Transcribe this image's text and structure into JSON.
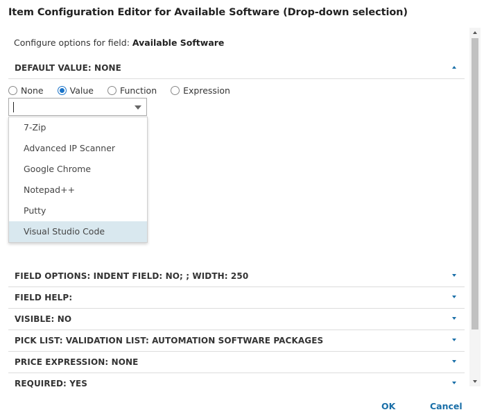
{
  "dialog": {
    "title": "Item Configuration Editor for Available Software (Drop-down selection)"
  },
  "config": {
    "prefix": "Configure options for field: ",
    "field_name": "Available Software"
  },
  "sections": {
    "default_value": "DEFAULT VALUE: NONE",
    "field_options": "FIELD OPTIONS: INDENT FIELD: NO; ; WIDTH: 250",
    "field_help": "FIELD HELP:",
    "visible": "VISIBLE: NO",
    "pick_list": "PICK LIST: VALIDATION LIST: AUTOMATION SOFTWARE PACKAGES",
    "price_expression": "PRICE EXPRESSION: NONE",
    "required": "REQUIRED: YES"
  },
  "radios": {
    "selected": "Value",
    "none": "None",
    "value": "Value",
    "function": "Function",
    "expression": "Expression"
  },
  "combo": {
    "value": ""
  },
  "dropdown": {
    "items": [
      "7-Zip",
      "Advanced IP Scanner",
      "Google Chrome",
      "Notepad++",
      "Putty",
      "Visual Studio Code"
    ],
    "highlighted": "Visual Studio Code"
  },
  "footer": {
    "ok_label": "OK",
    "cancel_label": "Cancel"
  },
  "colors": {
    "accent": "#1a6fa8",
    "highlight": "#d9e8ef"
  }
}
